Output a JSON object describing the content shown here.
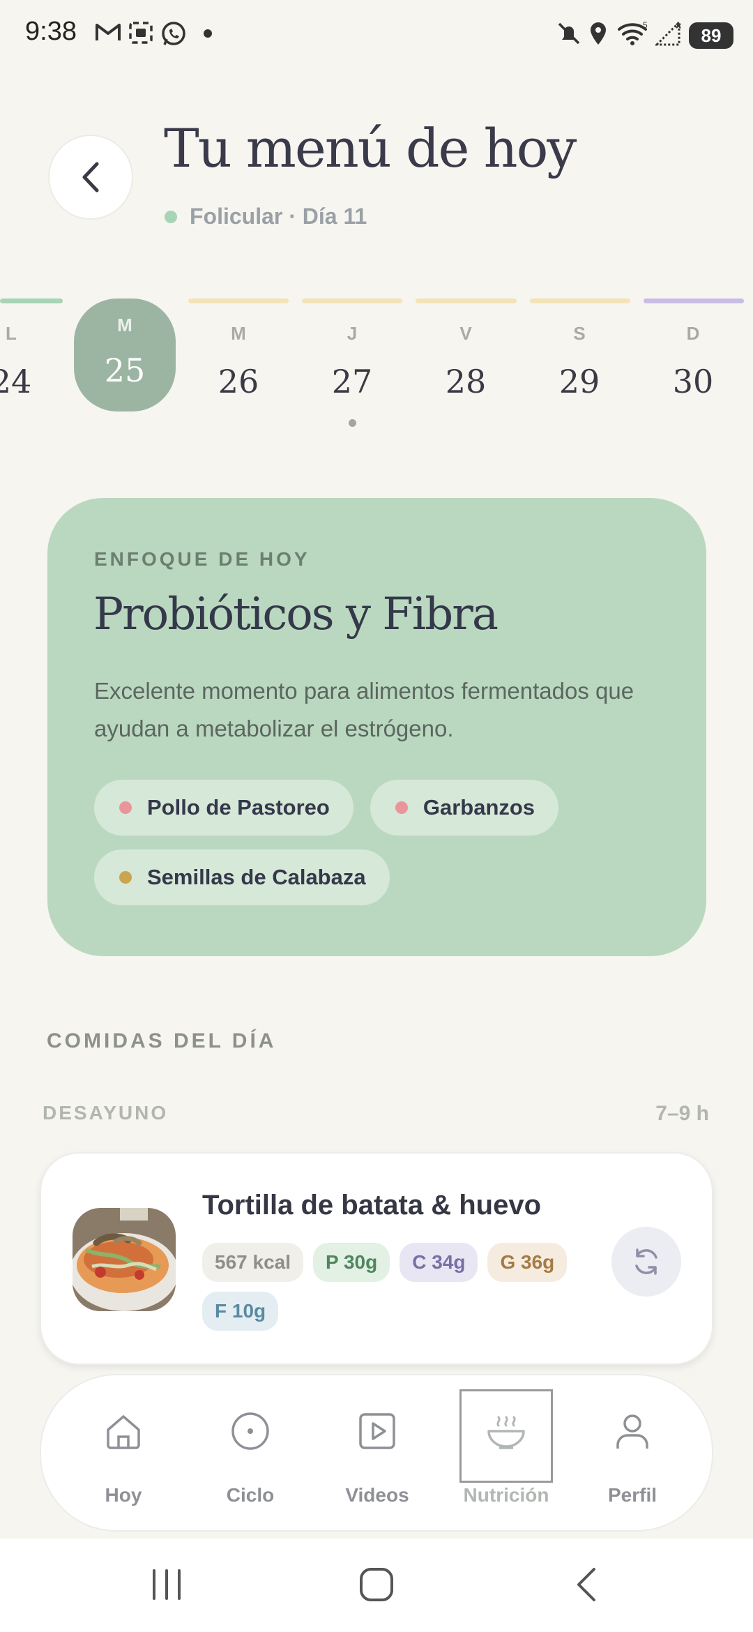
{
  "status": {
    "time": "9:38",
    "battery": "89"
  },
  "header": {
    "title": "Tu menú de hoy",
    "phase": "Folicular · Día 11"
  },
  "week": [
    {
      "letter": "L",
      "num": "24"
    },
    {
      "letter": "M",
      "num": "25",
      "selected": true
    },
    {
      "letter": "M",
      "num": "26"
    },
    {
      "letter": "J",
      "num": "27",
      "has_event": true
    },
    {
      "letter": "V",
      "num": "28"
    },
    {
      "letter": "S",
      "num": "29"
    },
    {
      "letter": "D",
      "num": "30"
    }
  ],
  "phase_colors": {
    "follicular": "#a6d4b4",
    "ovulatory": "#f3e3b6",
    "luteal": "#c9bde6"
  },
  "focus": {
    "eyebrow": "ENFOQUE DE HOY",
    "title": "Probióticos y Fibra",
    "description": "Excelente momento para alimentos fermentados que ayudan a metabolizar el estrógeno.",
    "chips": [
      {
        "label": "Pollo de Pastoreo",
        "color": "#e8969a"
      },
      {
        "label": "Garbanzos",
        "color": "#e8969a"
      },
      {
        "label": "Semillas de Calabaza",
        "color": "#c9a550"
      }
    ]
  },
  "meals": {
    "section_title": "COMIDAS DEL DÍA",
    "slot_label": "DESAYUNO",
    "slot_time": "7–9 h",
    "item": {
      "name": "Tortilla de batata & huevo",
      "kcal": "567 kcal",
      "protein": "P 30g",
      "carbs": "C 34g",
      "fat": "G 36g",
      "fiber": "F 10g"
    }
  },
  "nav": [
    {
      "label": "Hoy",
      "icon": "home-icon"
    },
    {
      "label": "Ciclo",
      "icon": "circle-dot-icon"
    },
    {
      "label": "Videos",
      "icon": "play-icon"
    },
    {
      "label": "Nutrición",
      "icon": "bowl-icon",
      "active": true
    },
    {
      "label": "Perfil",
      "icon": "user-icon"
    }
  ]
}
